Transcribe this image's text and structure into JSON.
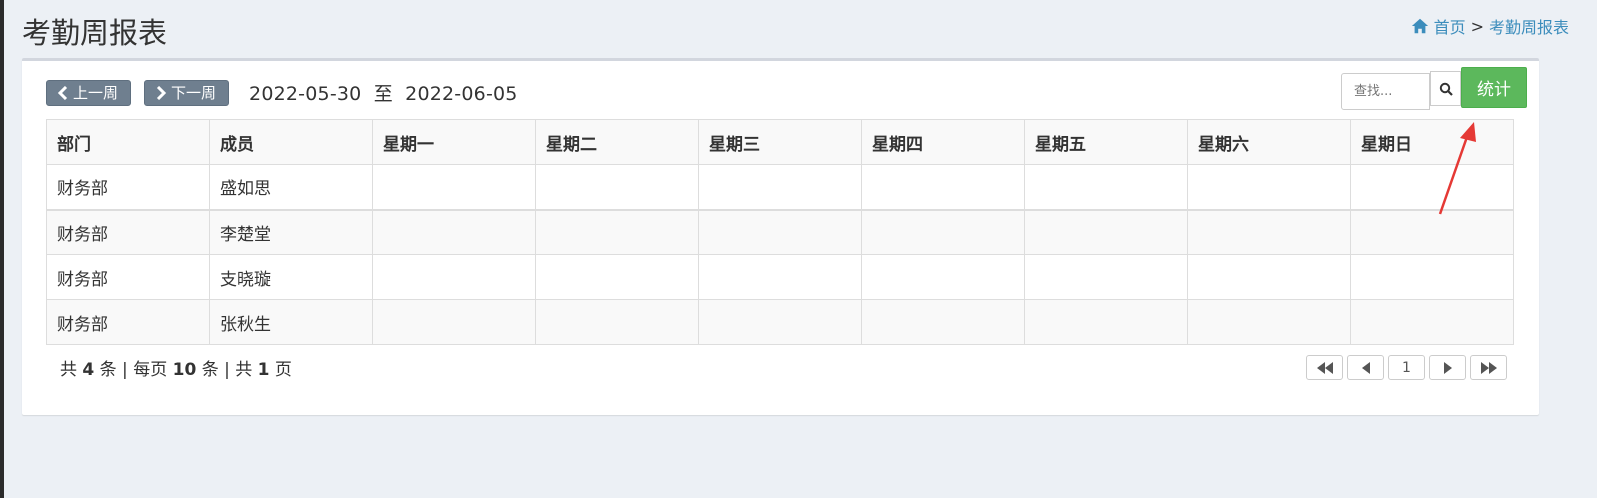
{
  "page": {
    "title": "考勤周报表"
  },
  "breadcrumb": {
    "home": "首页",
    "separator": ">",
    "current": "考勤周报表"
  },
  "toolbar": {
    "prev_week": "上一周",
    "next_week": "下一周",
    "date_start": "2022-05-30",
    "date_to": "至",
    "date_end": "2022-06-05"
  },
  "search": {
    "placeholder": "查找..."
  },
  "stat_button": "统计",
  "table": {
    "headers": [
      "部门",
      "成员",
      "星期一",
      "星期二",
      "星期三",
      "星期四",
      "星期五",
      "星期六",
      "星期日"
    ],
    "rows": [
      [
        "财务部",
        "盛如思",
        "",
        "",
        "",
        "",
        "",
        "",
        ""
      ],
      [
        "财务部",
        "李楚堂",
        "",
        "",
        "",
        "",
        "",
        "",
        ""
      ],
      [
        "财务部",
        "支晓璇",
        "",
        "",
        "",
        "",
        "",
        "",
        ""
      ],
      [
        "财务部",
        "张秋生",
        "",
        "",
        "",
        "",
        "",
        "",
        ""
      ]
    ]
  },
  "pagination": {
    "total_prefix": "共",
    "total": "4",
    "total_suffix": "条 |",
    "per_page_prefix": "每页",
    "per_page": "10",
    "per_page_suffix": "条 |",
    "pages_prefix": "共",
    "pages": "1",
    "pages_suffix": "页",
    "current_page": "1"
  },
  "colors": {
    "accent": "#3c8dbc",
    "success": "#5cb85c",
    "week_button": "#6f7f8f",
    "annotation_arrow": "#e53935"
  }
}
